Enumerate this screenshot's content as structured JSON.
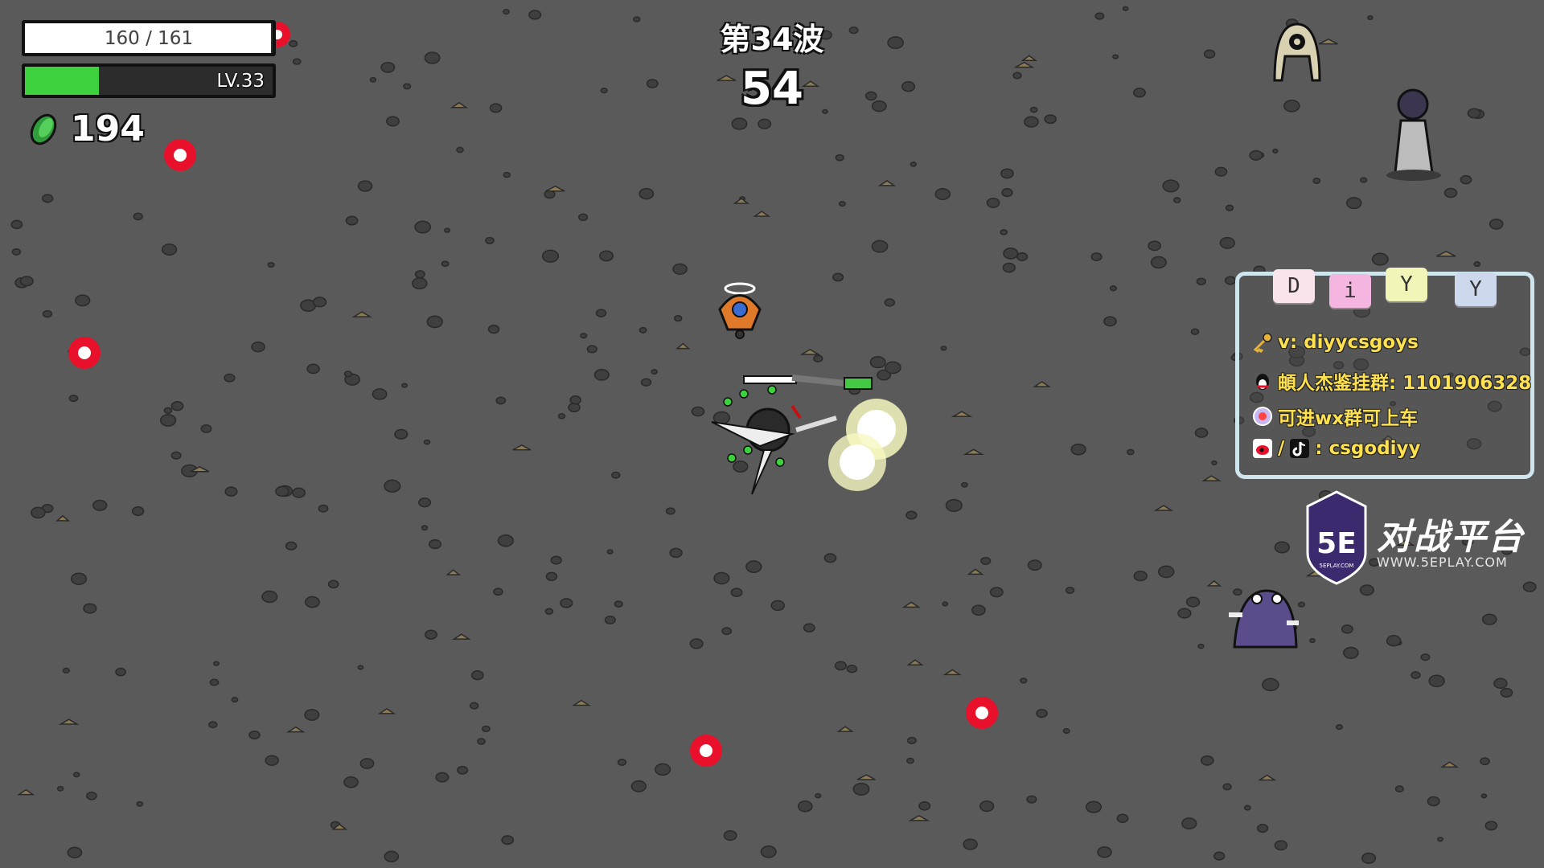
{
  "hud": {
    "hp_text": "160 / 161",
    "hp_fraction": 0.994,
    "level_text": "LV.33",
    "xp_fraction": 0.3,
    "materials": "194",
    "material_icon": "green-material-icon"
  },
  "wave": {
    "title": "第34波",
    "timer": "54"
  },
  "promo": {
    "tags": [
      "D",
      "i",
      "Y",
      "Y"
    ],
    "lines": [
      {
        "icon": "key-icon",
        "text": "v: diyycsgoys"
      },
      {
        "icon": "penguin-icon",
        "text": "頔人杰鉴挂群: 1101906328"
      },
      {
        "icon": "badge-icon",
        "text": "可进wx群可上车"
      },
      {
        "icon": "weibo-tiktok-icon",
        "text": "/",
        "text2": ": csgodiyy"
      }
    ]
  },
  "logo": {
    "mark": "5E",
    "brand": "对战平台",
    "url": "WWW.5EPLAY.COM",
    "small": "5EPLAY.COM"
  },
  "colors": {
    "background": "#5a5a5a",
    "hp_fill": "#ffffff",
    "xp_fill": "#3ed13e",
    "enemy_bullet": "#e8102a",
    "promo_text": "#ffe14d"
  }
}
